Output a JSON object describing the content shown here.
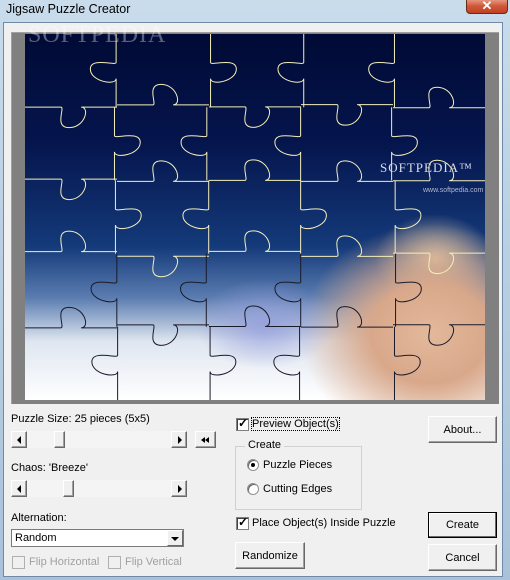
{
  "window": {
    "title": "Jigsaw Puzzle Creator",
    "close_glyph": "✕"
  },
  "preview": {
    "watermark": "SOFTPEDIA",
    "watermark_url": "www.softpedia.com",
    "logo_text": "SOFTPEDIA™",
    "logo_url": "www.softpedia.com",
    "grid": {
      "columns": 5,
      "rows": 5
    },
    "colors": {
      "frame": "#808080",
      "cut_line": "#f4efb8"
    }
  },
  "puzzle_size": {
    "label": "Puzzle Size: 25 pieces (5x5)",
    "slider_fraction": 0.2,
    "reset_button_icon": "rewind-icon"
  },
  "chaos": {
    "label": "Chaos: 'Breeze'",
    "slider_fraction": 0.27
  },
  "alternation": {
    "label": "Alternation:",
    "selected": "Random"
  },
  "flip": {
    "horizontal_label": "Flip Horizontal",
    "horizontal_checked": false,
    "vertical_label": "Flip Vertical",
    "vertical_checked": false,
    "enabled": false
  },
  "options": {
    "preview_objects_label": "Preview Object(s)",
    "preview_objects_checked": true,
    "create_group_title": "Create",
    "radio_puzzle_pieces": "Puzzle Pieces",
    "radio_cutting_edges": "Cutting Edges",
    "selected_radio": "Puzzle Pieces",
    "place_inside_label": "Place Object(s) Inside Puzzle",
    "place_inside_checked": true
  },
  "buttons": {
    "about": "About...",
    "randomize": "Randomize",
    "create": "Create",
    "cancel": "Cancel"
  }
}
